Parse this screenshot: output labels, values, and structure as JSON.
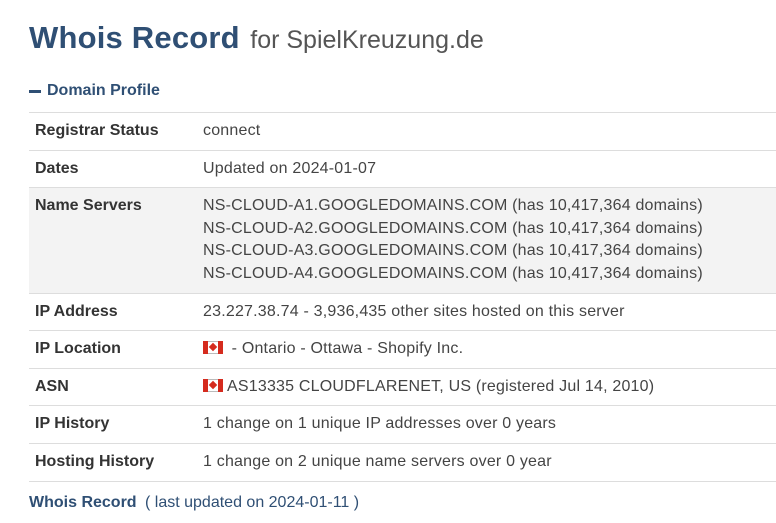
{
  "header": {
    "title": "Whois Record",
    "subtitle": "for SpielKreuzung.de"
  },
  "section": {
    "label": "Domain Profile",
    "icon": "minus-icon"
  },
  "rows": [
    {
      "label": "Registrar Status",
      "value": "connect"
    },
    {
      "label": "Dates",
      "value": "Updated on 2024-01-07"
    },
    {
      "label": "Name Servers",
      "lines": [
        "NS-CLOUD-A1.GOOGLEDOMAINS.COM (has 10,417,364 domains)",
        "NS-CLOUD-A2.GOOGLEDOMAINS.COM (has 10,417,364 domains)",
        "NS-CLOUD-A3.GOOGLEDOMAINS.COM (has 10,417,364 domains)",
        "NS-CLOUD-A4.GOOGLEDOMAINS.COM (has 10,417,364 domains)"
      ]
    },
    {
      "label": "IP Address",
      "value": "23.227.38.74 - 3,936,435 other sites hosted on this server"
    },
    {
      "label": "IP Location",
      "value": " - Ontario - Ottawa - Shopify Inc.",
      "flag": "canada-flag-icon"
    },
    {
      "label": "ASN",
      "value": "AS13335 CLOUDFLARENET, US (registered Jul 14, 2010)",
      "flag": "canada-flag-icon"
    },
    {
      "label": "IP History",
      "value": "1 change on 1 unique IP addresses over 0 years"
    },
    {
      "label": "Hosting History",
      "value": "1 change on 2 unique name servers over 0 year"
    }
  ],
  "footer": {
    "title": "Whois Record",
    "note": "( last updated on 2024-01-11 )"
  },
  "colors": {
    "accent": "#2f4f74",
    "shaded_row": "#f3f3f3",
    "flag_red": "#d52b1e"
  }
}
